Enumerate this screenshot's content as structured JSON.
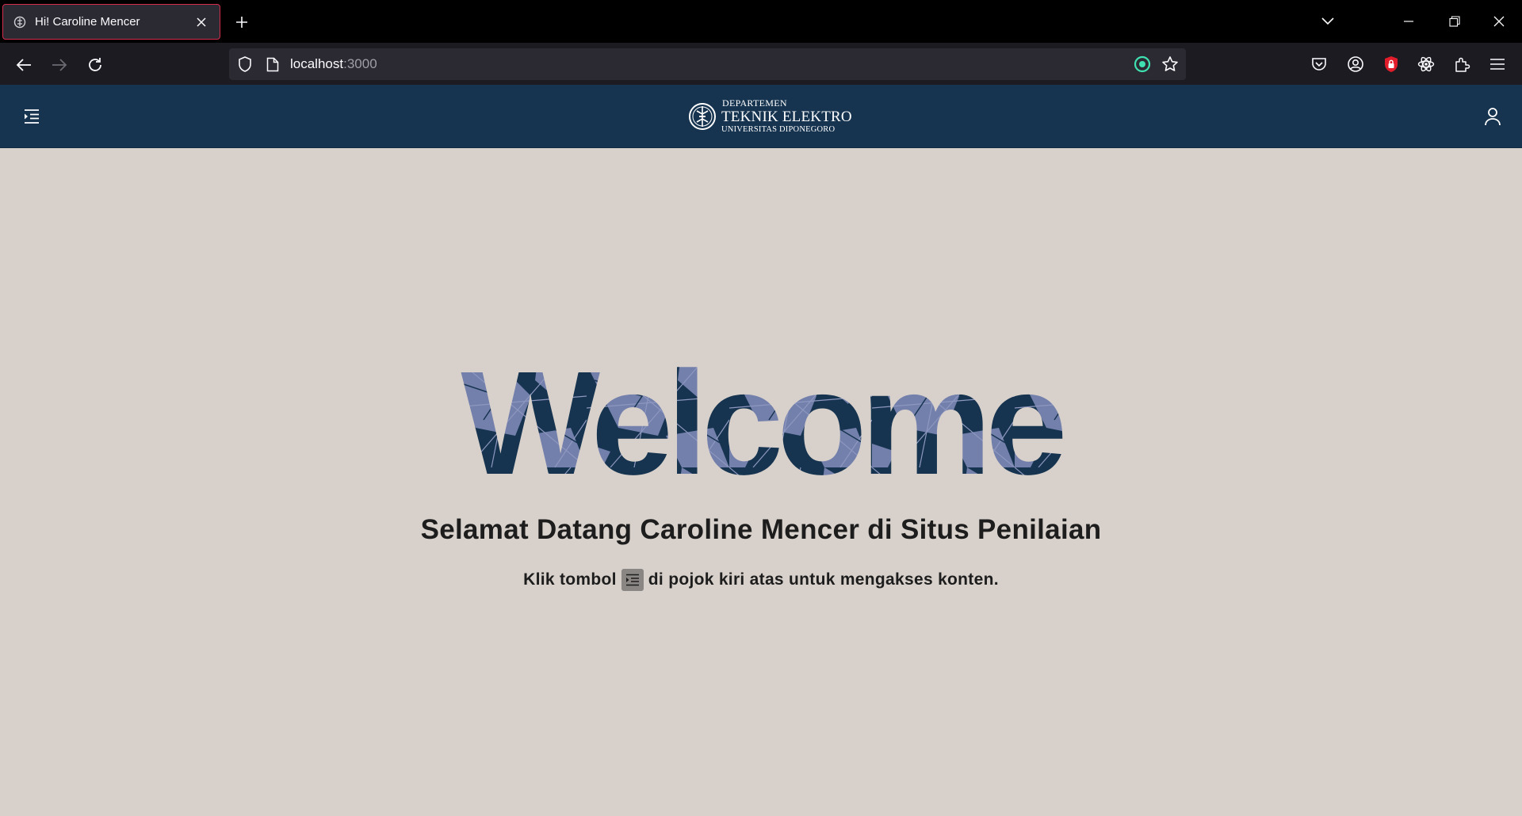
{
  "browser": {
    "tab_title": "Hi! Caroline Mencer",
    "url_host": "localhost",
    "url_port": ":3000"
  },
  "header": {
    "brand_line1": "DEPARTEMEN",
    "brand_line2": "TEKNIK ELEKTRO",
    "brand_line3": "UNIVERSITAS DIPONEGORO"
  },
  "main": {
    "welcome": "Welcome",
    "subtitle": "Selamat Datang Caroline Mencer di Situs Penilaian",
    "hint_before": "Klik tombol",
    "hint_after": "di pojok kiri atas untuk mengakses konten."
  },
  "colors": {
    "header_bg": "#163450",
    "page_bg": "#d8d1cb",
    "welcome_dark": "#163450",
    "welcome_light": "#7480ac"
  }
}
